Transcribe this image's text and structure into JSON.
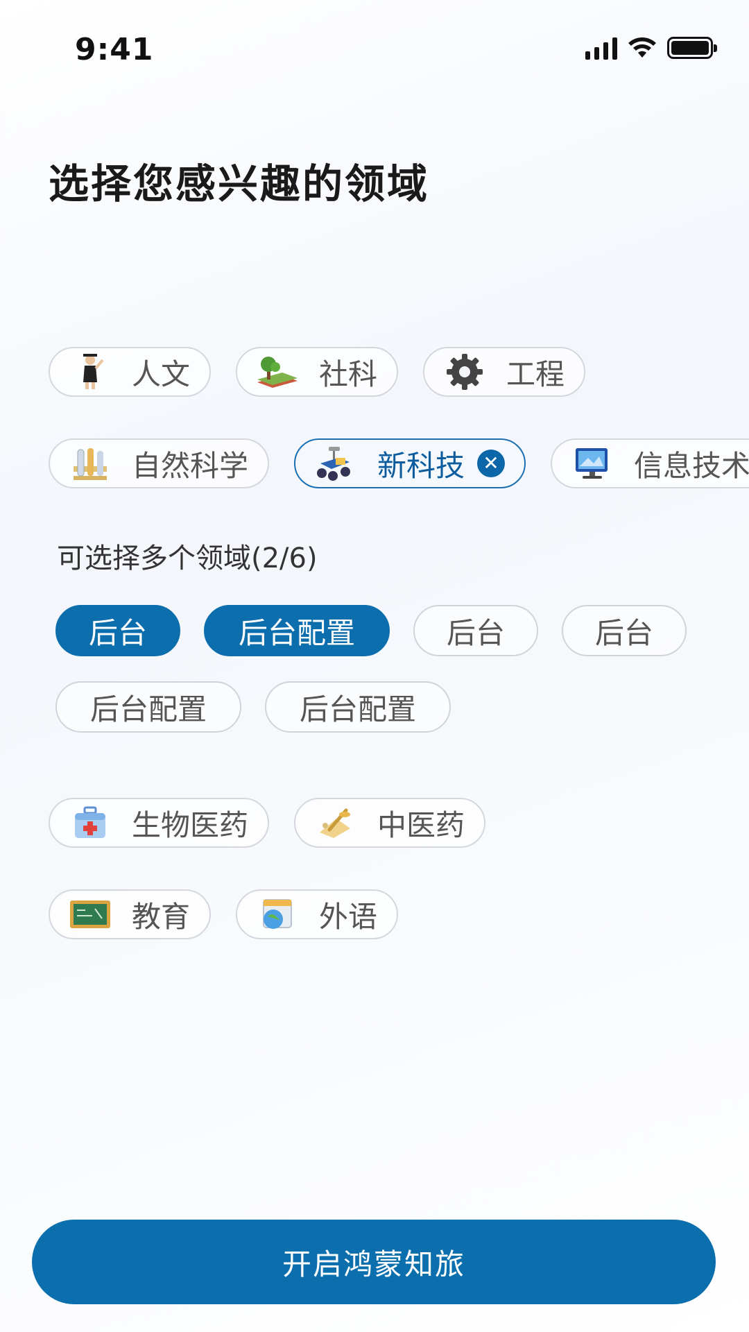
{
  "status": {
    "time": "9:41"
  },
  "title": "选择您感兴趣的领域",
  "categories_row1": [
    {
      "label": "人文",
      "icon": "graduate-icon"
    },
    {
      "label": "社科",
      "icon": "landscape-icon"
    },
    {
      "label": "工程",
      "icon": "gear-icon"
    }
  ],
  "categories_row2": [
    {
      "label": "自然科学",
      "icon": "test-tubes-icon"
    },
    {
      "label": "新科技",
      "icon": "rover-icon",
      "selected": true
    },
    {
      "label": "信息技术",
      "icon": "monitor-icon"
    }
  ],
  "hint": "可选择多个领域(2/6)",
  "subtopics_row1": [
    {
      "label": "后台",
      "selected": true
    },
    {
      "label": "后台配置",
      "selected": true
    },
    {
      "label": "后台",
      "selected": false
    },
    {
      "label": "后台",
      "selected": false
    }
  ],
  "subtopics_row2": [
    {
      "label": "后台配置",
      "selected": false
    },
    {
      "label": "后台配置",
      "selected": false
    }
  ],
  "categories_row3": [
    {
      "label": "生物医药",
      "icon": "medical-kit-icon"
    },
    {
      "label": "中医药",
      "icon": "herbal-icon"
    }
  ],
  "categories_row4": [
    {
      "label": "教育",
      "icon": "chalkboard-icon"
    },
    {
      "label": "外语",
      "icon": "globe-calendar-icon"
    }
  ],
  "cta_label": "开启鸿蒙知旅",
  "colors": {
    "accent": "#0b6fae",
    "chip_border": "#d4d8de"
  }
}
